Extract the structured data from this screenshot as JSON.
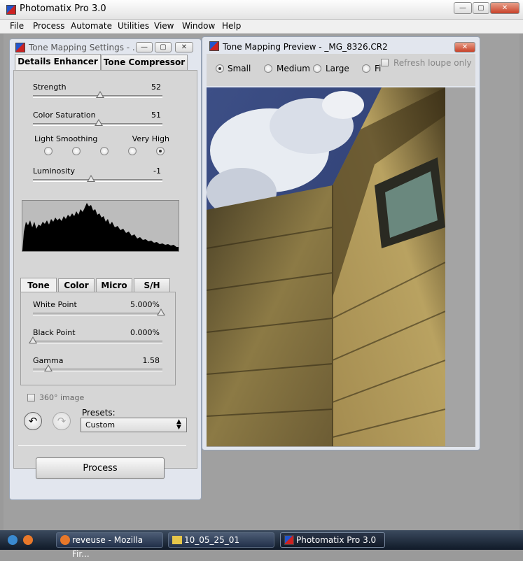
{
  "app": {
    "title": "Photomatix Pro 3.0",
    "menu": [
      "File",
      "Process",
      "Automate",
      "Utilities",
      "View",
      "Window",
      "Help"
    ],
    "window_buttons": {
      "minimize": "—",
      "maximize": "▢",
      "close": "✕"
    }
  },
  "settings": {
    "title": "Tone Mapping Settings - ...",
    "tabs": [
      "Details Enhancer",
      "Tone Compressor"
    ],
    "strength": {
      "label": "Strength",
      "value": "52",
      "fraction": 0.52
    },
    "color_saturation": {
      "label": "Color Saturation",
      "value": "51",
      "fraction": 0.51
    },
    "light_smoothing": {
      "label": "Light Smoothing",
      "value": "Very High",
      "options": 5,
      "selected_index": 4
    },
    "luminosity": {
      "label": "Luminosity",
      "value": "-1",
      "fraction": 0.45
    },
    "subtabs": [
      "Tone",
      "Color",
      "Micro",
      "S/H"
    ],
    "white_point": {
      "label": "White Point",
      "value": "5.000%",
      "fraction": 0.99
    },
    "black_point": {
      "label": "Black Point",
      "value": "0.000%",
      "fraction": 0.0
    },
    "gamma": {
      "label": "Gamma",
      "value": "1.58",
      "fraction": 0.12
    },
    "image_360": {
      "label": "360° image",
      "checked": false
    },
    "presets_label": "Presets:",
    "preset_value": "Custom",
    "process_label": "Process",
    "undo_icon": "undo-arrow-icon",
    "redo_icon": "redo-arrow-icon"
  },
  "preview": {
    "title": "Tone Mapping Preview - _MG_8326.CR2",
    "sizes": [
      "Small",
      "Medium",
      "Large",
      "Fi"
    ],
    "selected_size": "Small",
    "refresh_loupe_label": "Refresh loupe only",
    "refresh_loupe_checked": false
  },
  "taskbar": {
    "items": [
      "reveuse - Mozilla Fir...",
      "10_05_25_01",
      "Photomatix Pro 3.0"
    ],
    "active_item": "Photomatix Pro 3.0"
  },
  "colors": {
    "accent": "#2255cc",
    "close_red": "#c8422a",
    "panel_bg": "#d6d6d6"
  }
}
